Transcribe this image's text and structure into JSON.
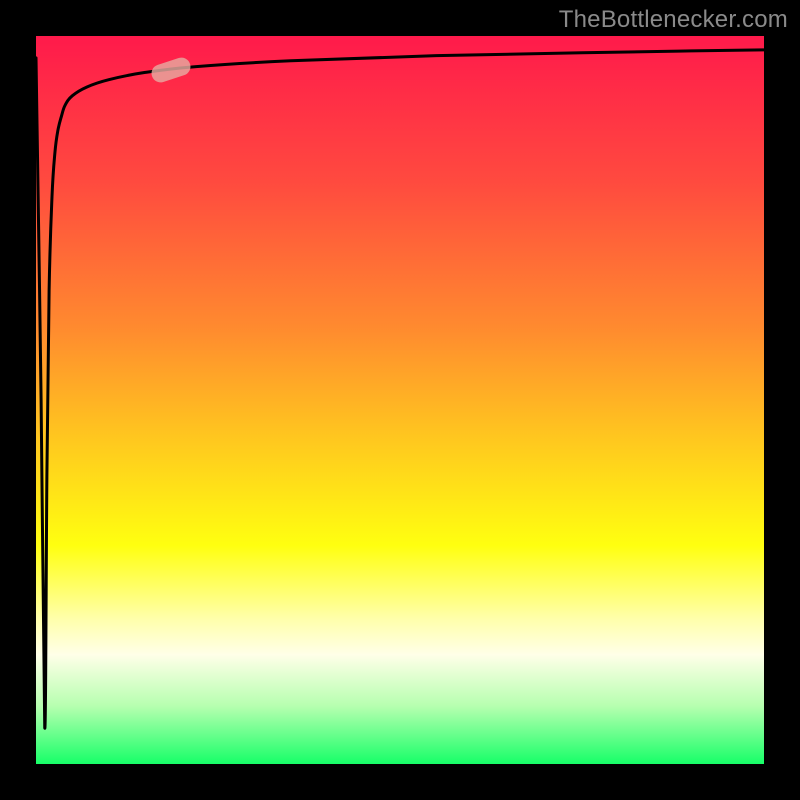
{
  "attribution_text": "TheBottlenecker.com",
  "chart_data": {
    "type": "line",
    "title": "",
    "xlabel": "",
    "ylabel": "",
    "xlim": [
      0,
      100
    ],
    "ylim": [
      0,
      100
    ],
    "gradient": {
      "stops": [
        {
          "offset": 0,
          "color": "#ff1a4b"
        },
        {
          "offset": 20,
          "color": "#ff4a3f"
        },
        {
          "offset": 40,
          "color": "#ff8a2f"
        },
        {
          "offset": 55,
          "color": "#ffc61f"
        },
        {
          "offset": 70,
          "color": "#ffff10"
        },
        {
          "offset": 80,
          "color": "#ffffaa"
        },
        {
          "offset": 85,
          "color": "#ffffe8"
        },
        {
          "offset": 92,
          "color": "#b7ffb0"
        },
        {
          "offset": 100,
          "color": "#17ff68"
        }
      ]
    },
    "series": [
      {
        "name": "bottleneck-curve",
        "x": [
          0.0,
          0.7,
          1.2,
          1.5,
          1.8,
          2.2,
          2.6,
          3.0,
          3.5,
          4.0,
          5.0,
          7.0,
          10.0,
          15.0,
          22.0,
          35.0,
          55.0,
          75.0,
          90.0,
          100.0
        ],
        "y": [
          97.0,
          50.0,
          5.0,
          40.0,
          65.0,
          78.0,
          84.0,
          87.0,
          89.0,
          90.5,
          91.8,
          93.0,
          94.0,
          95.0,
          95.8,
          96.6,
          97.3,
          97.7,
          97.95,
          98.1
        ],
        "color": "#000000",
        "width": 3
      }
    ],
    "marker": {
      "label": "highlight-marker",
      "x": 18.5,
      "y": 95.3,
      "angle_deg": -18,
      "color": "#e6aaa0",
      "opacity": 0.82
    }
  }
}
